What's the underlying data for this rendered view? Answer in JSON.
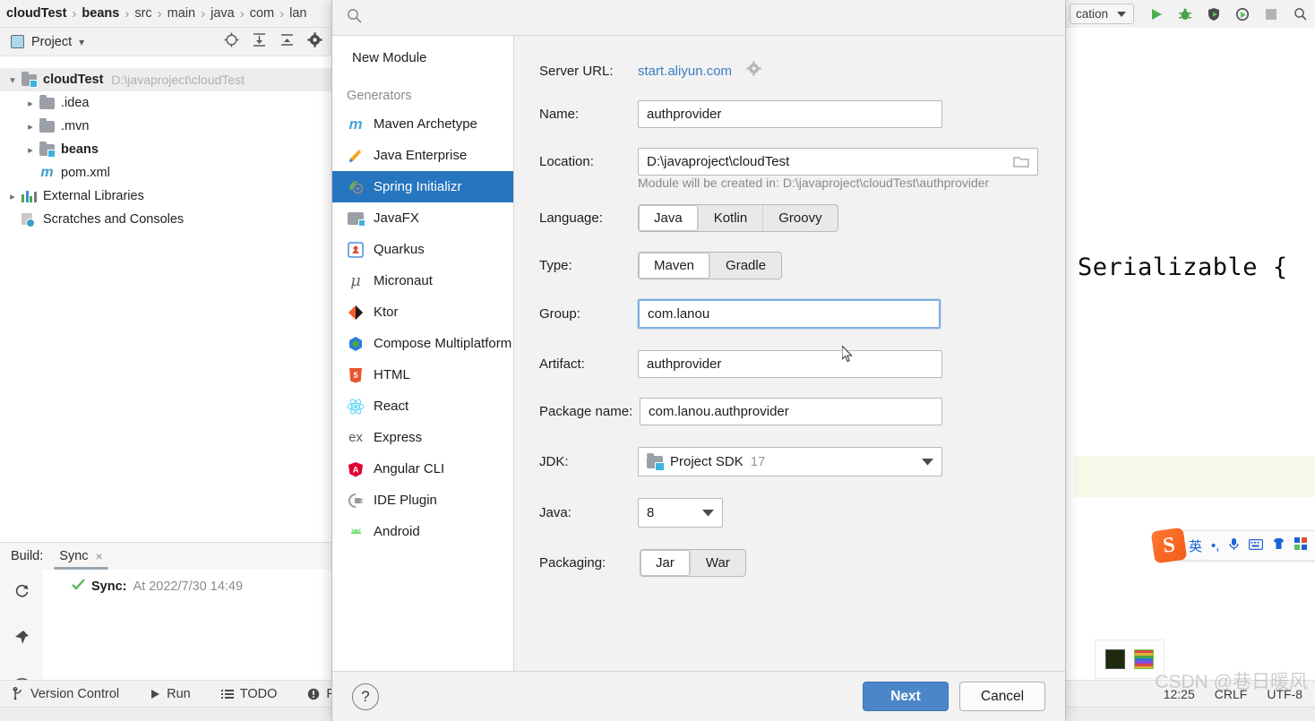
{
  "ide": {
    "breadcrumb": [
      "cloudTest",
      "beans",
      "src",
      "main",
      "java",
      "com",
      "lan"
    ],
    "breadcrumb_sep": "›",
    "run_config_label": "cation",
    "project_tool": {
      "title": "Project",
      "dropdown_arrow": "▾",
      "icons": [
        "locate-icon",
        "expand-all-icon",
        "collapse-all-icon",
        "gear-icon"
      ]
    },
    "tree": [
      {
        "label": "cloudTest",
        "path": "D:\\javaproject\\cloudTest",
        "bold": true,
        "indent": 0,
        "chevron": "⌄",
        "icon": "module-folder",
        "selected": true
      },
      {
        "label": ".idea",
        "path": "",
        "bold": false,
        "indent": 1,
        "chevron": "›",
        "icon": "folder",
        "selected": false
      },
      {
        "label": ".mvn",
        "path": "",
        "bold": false,
        "indent": 1,
        "chevron": "›",
        "icon": "folder",
        "selected": false
      },
      {
        "label": "beans",
        "path": "",
        "bold": true,
        "indent": 1,
        "chevron": "›",
        "icon": "module-folder",
        "selected": false
      },
      {
        "label": "pom.xml",
        "path": "",
        "bold": false,
        "indent": 2,
        "chevron": "",
        "icon": "maven-m",
        "selected": false
      },
      {
        "label": "External Libraries",
        "path": "",
        "bold": false,
        "indent": 0,
        "chevron": "›",
        "icon": "libraries",
        "selected": false
      },
      {
        "label": "Scratches and Consoles",
        "path": "",
        "bold": false,
        "indent": 0,
        "chevron": "",
        "icon": "scratches",
        "selected": false
      }
    ],
    "build": {
      "label": "Build:",
      "tab": "Sync",
      "close": "×",
      "sync_title": "Sync:",
      "sync_detail": "At 2022/7/30 14:49",
      "side_icons": [
        "refresh-icon",
        "pin-icon",
        "eye-icon"
      ]
    },
    "statusbar": {
      "items": [
        "Version Control",
        "Run",
        "TODO",
        "Pr"
      ],
      "time": "12:25",
      "line_sep": "CRLF",
      "encoding": "UTF-8"
    },
    "editor": {
      "code": "Serializable {"
    },
    "watermark": "CSDN @巷日暖风",
    "ime": {
      "lang": "英",
      "punct": "•,",
      "icons": [
        "mic-icon",
        "keyboard-icon",
        "skin-icon",
        "apps-icon"
      ]
    }
  },
  "dialog": {
    "search_placeholder": "",
    "new_module_label": "New Module",
    "generators_header": "Generators",
    "generators": [
      {
        "label": "Maven Archetype",
        "icon": "maven-icon",
        "active": false
      },
      {
        "label": "Java Enterprise",
        "icon": "java-enterprise-icon",
        "active": false
      },
      {
        "label": "Spring Initializr",
        "icon": "spring-icon",
        "active": true
      },
      {
        "label": "JavaFX",
        "icon": "javafx-icon",
        "active": false
      },
      {
        "label": "Quarkus",
        "icon": "quarkus-icon",
        "active": false
      },
      {
        "label": "Micronaut",
        "icon": "micronaut-icon",
        "active": false
      },
      {
        "label": "Ktor",
        "icon": "ktor-icon",
        "active": false
      },
      {
        "label": "Compose Multiplatform",
        "icon": "compose-icon",
        "active": false
      },
      {
        "label": "HTML",
        "icon": "html5-icon",
        "active": false
      },
      {
        "label": "React",
        "icon": "react-icon",
        "active": false
      },
      {
        "label": "Express",
        "icon": "express-icon",
        "active": false
      },
      {
        "label": "Angular CLI",
        "icon": "angular-icon",
        "active": false
      },
      {
        "label": "IDE Plugin",
        "icon": "ide-plugin-icon",
        "active": false
      },
      {
        "label": "Android",
        "icon": "android-icon",
        "active": false
      }
    ],
    "form": {
      "server_url_label": "Server URL:",
      "server_url_value": "start.aliyun.com",
      "name_label": "Name:",
      "name_value": "authprovider",
      "location_label": "Location:",
      "location_value": "D:\\javaproject\\cloudTest",
      "location_hint": "Module will be created in: D:\\javaproject\\cloudTest\\authprovider",
      "language_label": "Language:",
      "language_options": [
        "Java",
        "Kotlin",
        "Groovy"
      ],
      "language_selected": "Java",
      "type_label": "Type:",
      "type_options": [
        "Maven",
        "Gradle"
      ],
      "type_selected": "Maven",
      "group_label": "Group:",
      "group_value": "com.lanou",
      "artifact_label": "Artifact:",
      "artifact_value": "authprovider",
      "package_label": "Package name:",
      "package_value": "com.lanou.authprovider",
      "jdk_label": "JDK:",
      "jdk_value": "Project SDK",
      "jdk_version": "17",
      "java_label": "Java:",
      "java_value": "8",
      "packaging_label": "Packaging:",
      "packaging_options": [
        "Jar",
        "War"
      ],
      "packaging_selected": "Jar"
    },
    "footer": {
      "help_label": "?",
      "next_label": "Next",
      "cancel_label": "Cancel"
    }
  },
  "colors": {
    "accent_blue": "#2675bf",
    "primary_button": "#4a86c8",
    "link_blue": "#3a7fc1",
    "panel_bg": "#f2f2f2"
  }
}
